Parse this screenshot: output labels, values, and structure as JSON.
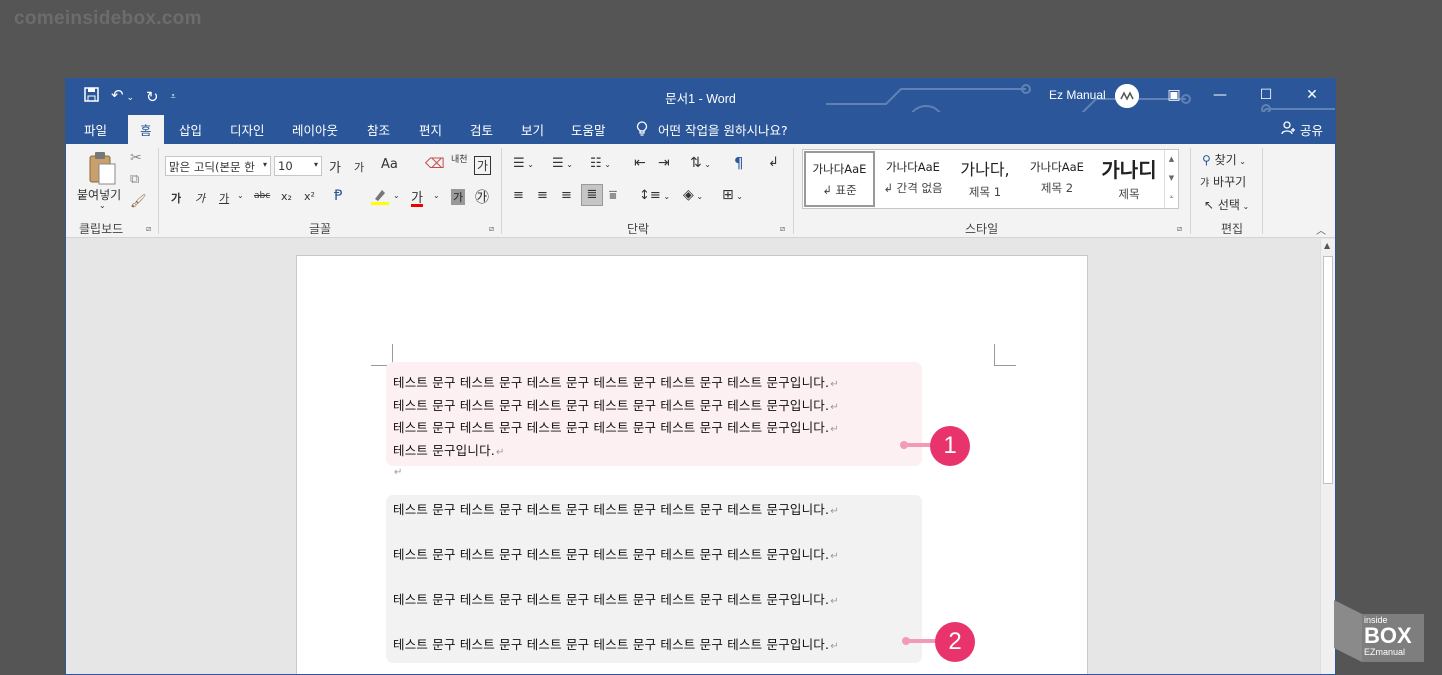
{
  "watermark": "comeinsidebox.com",
  "window": {
    "title": "문서1  -  Word",
    "user_name": "Ez Manual"
  },
  "tabs": [
    "파일",
    "홈",
    "삽입",
    "디자인",
    "레이아웃",
    "참조",
    "편지",
    "검토",
    "보기",
    "도움말"
  ],
  "active_tab": "홈",
  "tell_me": "어떤 작업을 원하시나요?",
  "share": "공유",
  "ribbon": {
    "clipboard": {
      "paste_label": "붙여넣기",
      "group": "클립보드"
    },
    "font": {
      "name": "맑은 고딕(본문 한",
      "size": "10",
      "group": "글꼴",
      "grow": "가",
      "shrink": "가",
      "case": "Aa",
      "bold": "가",
      "italic": "가",
      "underline": "가",
      "strike": "abc",
      "sub": "x₂",
      "sup": "x²",
      "color": "가",
      "char_shade": "가",
      "enclose": "㉮",
      "phonetic": "내천",
      "border_char": "가"
    },
    "paragraph": {
      "group": "단락"
    },
    "styles": {
      "group": "스타일",
      "items": [
        {
          "preview": "가나다AaE",
          "name": "↲ 표준"
        },
        {
          "preview": "가나다AaE",
          "name": "↲ 간격 없음"
        },
        {
          "preview": "가나다,",
          "name": "제목 1"
        },
        {
          "preview": "가나다AaE",
          "name": "제목 2"
        },
        {
          "preview": "가나디",
          "name": "제목"
        }
      ]
    },
    "editing": {
      "group": "편집",
      "find": "찾기",
      "replace": "바꾸기",
      "select": "선택"
    }
  },
  "document": {
    "block1": [
      "테스트 문구 테스트 문구 테스트 문구 테스트 문구 테스트 문구 테스트 문구입니다.",
      "테스트 문구 테스트 문구 테스트 문구 테스트 문구 테스트 문구 테스트 문구입니다.",
      "테스트 문구 테스트 문구 테스트 문구 테스트 문구 테스트 문구 테스트 문구입니다.",
      "테스트 문구입니다."
    ],
    "block2": [
      "테스트 문구 테스트 문구 테스트 문구 테스트 문구 테스트 문구 테스트 문구입니다.",
      "테스트 문구 테스트 문구 테스트 문구 테스트 문구 테스트 문구 테스트 문구입니다.",
      "테스트 문구 테스트 문구 테스트 문구 테스트 문구 테스트 문구 테스트 문구입니다.",
      "테스트 문구 테스트 문구 테스트 문구 테스트 문구 테스트 문구 테스트 문구입니다."
    ],
    "pilcrow": "↵"
  },
  "annotations": [
    "1",
    "2"
  ],
  "logo": {
    "line1": "inside",
    "line2": "BOX",
    "line3": "EZmanual"
  },
  "colors": {
    "word_blue": "#2b579a",
    "badge_pink": "#e8336d",
    "connector_pink": "#f29bb8"
  }
}
